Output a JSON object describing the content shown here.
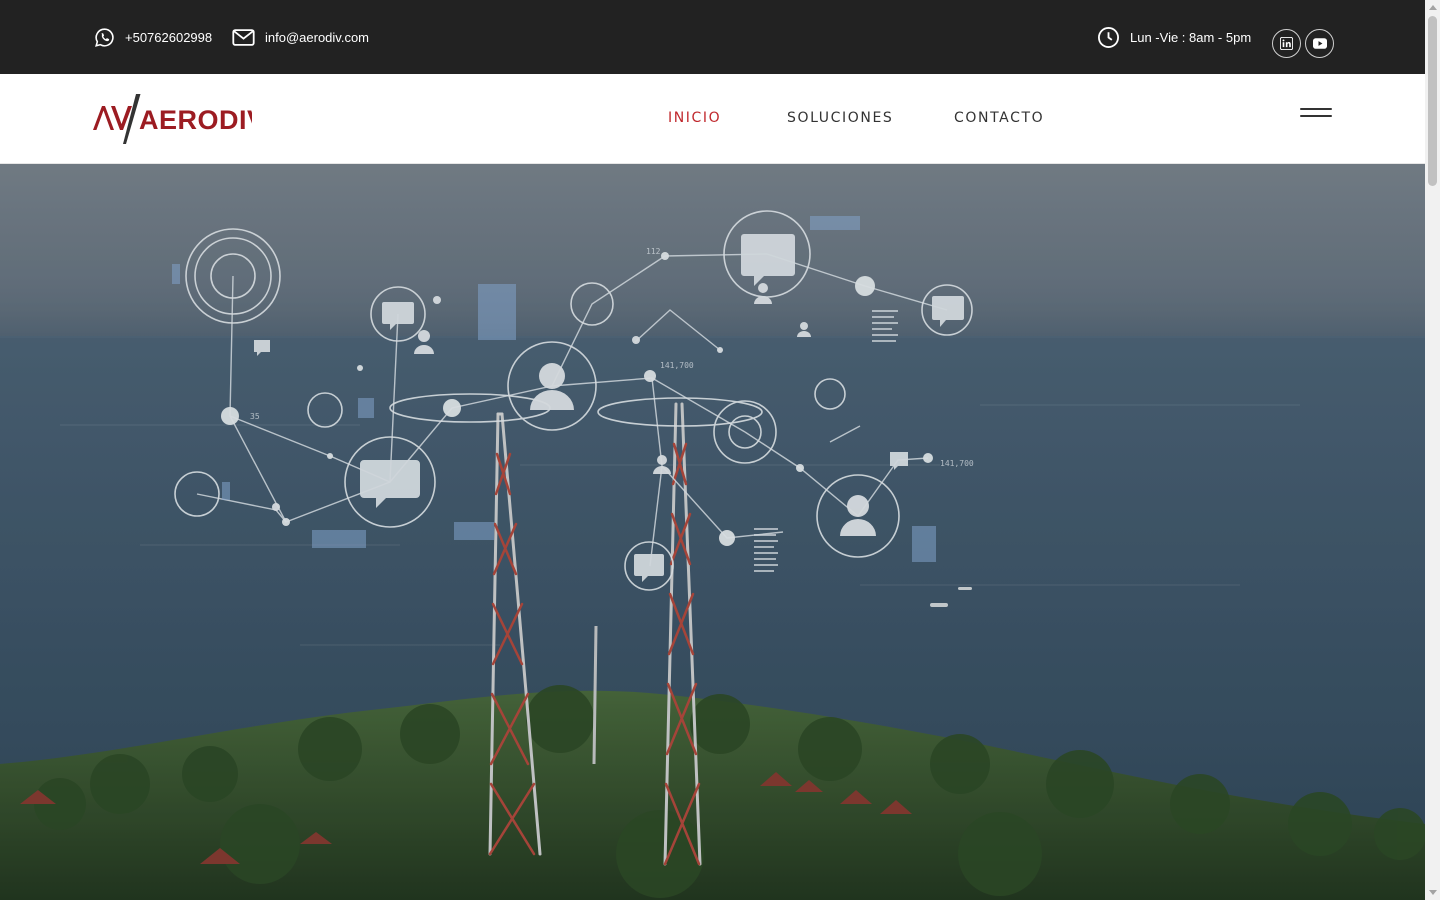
{
  "topbar": {
    "phone": "+50762602998",
    "email": "info@aerodiv.com",
    "hours": "Lun -Vie : 8am - 5pm",
    "icons": {
      "phone": "whatsapp-icon",
      "email": "mail-icon",
      "hours": "clock-icon",
      "social": [
        "linkedin-icon",
        "youtube-icon"
      ]
    }
  },
  "header": {
    "logo_text": "AERODIV",
    "logo_mark": "AV",
    "nav": [
      {
        "label": "INICIO",
        "active": true
      },
      {
        "label": "SOLUCIONES",
        "active": false
      },
      {
        "label": "CONTACTO",
        "active": false
      }
    ],
    "menu_icon": "hamburger-icon"
  },
  "hero": {
    "image": "telecom-towers-coast-network-overlay",
    "overlay_labels": [
      "35",
      "141,700",
      "141,700",
      "112"
    ]
  },
  "colors": {
    "topbar_bg": "#222222",
    "accent": "#c0282d",
    "nav_text": "#333333"
  }
}
